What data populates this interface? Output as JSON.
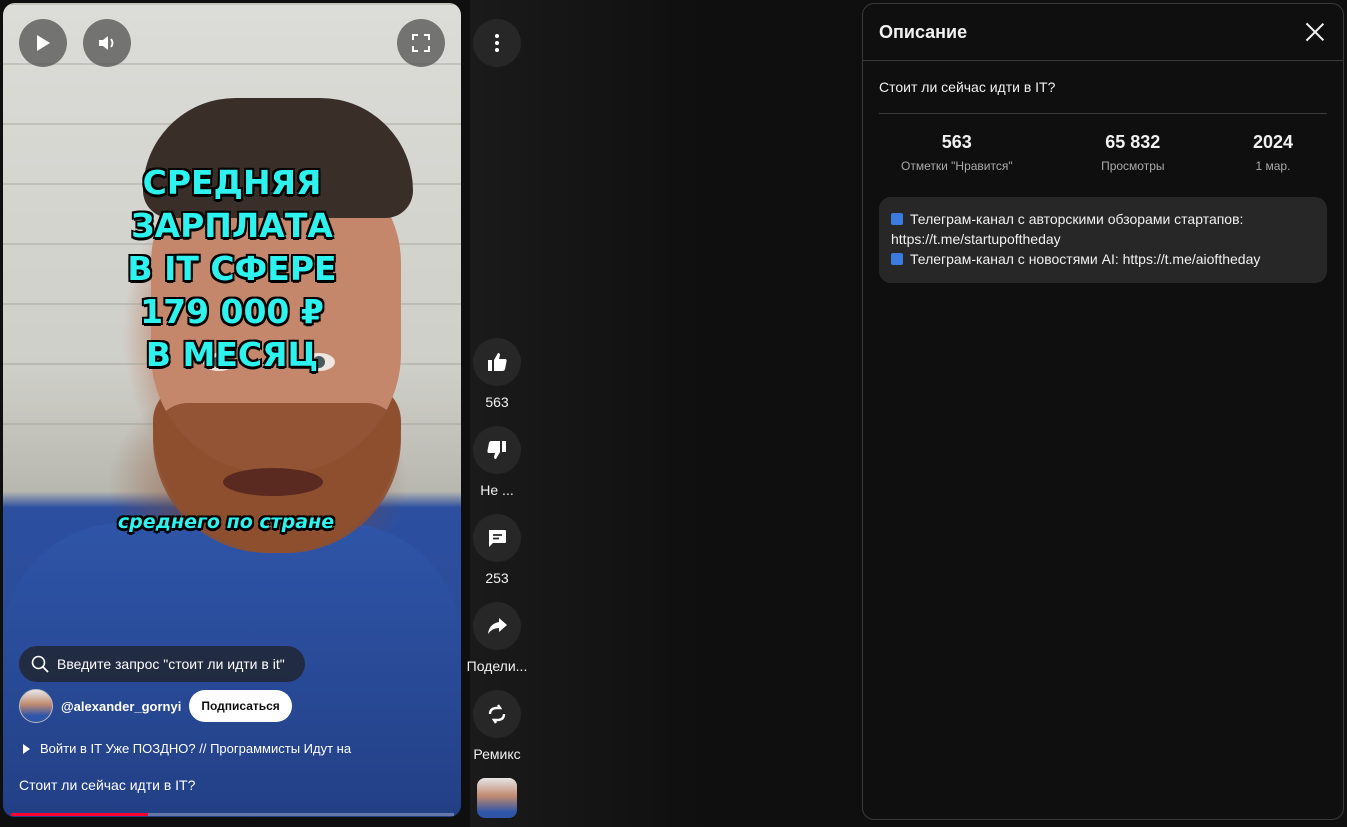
{
  "video": {
    "overlay_lines": [
      "СРЕДНЯЯ",
      "ЗАРПЛАТА",
      "В IT СФЕРЕ",
      "179 000 ₽",
      "В МЕСЯЦ"
    ],
    "caption": "среднего по стране",
    "search_text": "Введите запрос \"стоит ли идти в it\"",
    "channel_handle": "@alexander_gornyi",
    "subscribe_label": "Подписаться",
    "related_video": "Войти в IT Уже ПОЗДНО? // Программисты Идут на",
    "title": "Стоит ли сейчас идти в IT?",
    "progress_fraction": 0.31
  },
  "rail": {
    "like_count": "563",
    "dislike_label": "Не ...",
    "comment_count": "253",
    "share_label": "Подели...",
    "remix_label": "Ремикс"
  },
  "panel": {
    "header": "Описание",
    "video_title": "Стоит ли сейчас идти в IT?",
    "stats": [
      {
        "value": "563",
        "label": "Отметки \"Нравится\""
      },
      {
        "value": "65 832",
        "label": "Просмотры"
      },
      {
        "value": "2024",
        "label": "1 мар."
      }
    ],
    "description_lines": [
      "Телеграм-канал с авторскими обзорами стартапов: https://t.me/startupoftheday",
      "Телеграм-канал с новостями AI: https://t.me/aioftheday"
    ]
  },
  "colors": {
    "accent_red": "#ff0033",
    "overlay_cyan": "#2ef2ee"
  }
}
